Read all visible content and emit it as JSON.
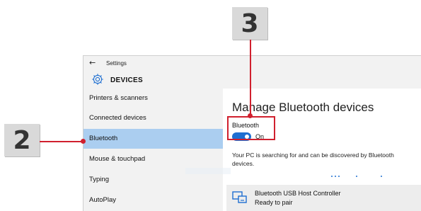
{
  "callouts": {
    "step3": "3",
    "step2": "2"
  },
  "window": {
    "back_glyph": "←",
    "title": "Settings"
  },
  "header": {
    "icon": "gear-icon",
    "label": "DEVICES"
  },
  "sidebar": {
    "items": [
      {
        "label": "Printers & scanners"
      },
      {
        "label": "Connected devices"
      },
      {
        "label": "Bluetooth"
      },
      {
        "label": "Mouse & touchpad"
      },
      {
        "label": "Typing"
      },
      {
        "label": "AutoPlay"
      }
    ],
    "selected": "Bluetooth"
  },
  "main": {
    "title": "Manage Bluetooth devices",
    "bluetooth_label": "Bluetooth",
    "toggle_state": "On",
    "searching_text": "Your PC is searching for and can be discovered by Bluetooth devices.",
    "device": {
      "icon": "bluetooth-controller-icon",
      "name": "Bluetooth USB Host Controller",
      "status": "Ready to pair"
    }
  },
  "colors": {
    "accent": "#1f6fd1",
    "selection": "#abcef0",
    "callout": "#d0202e",
    "badge": "#d9d9d9"
  }
}
